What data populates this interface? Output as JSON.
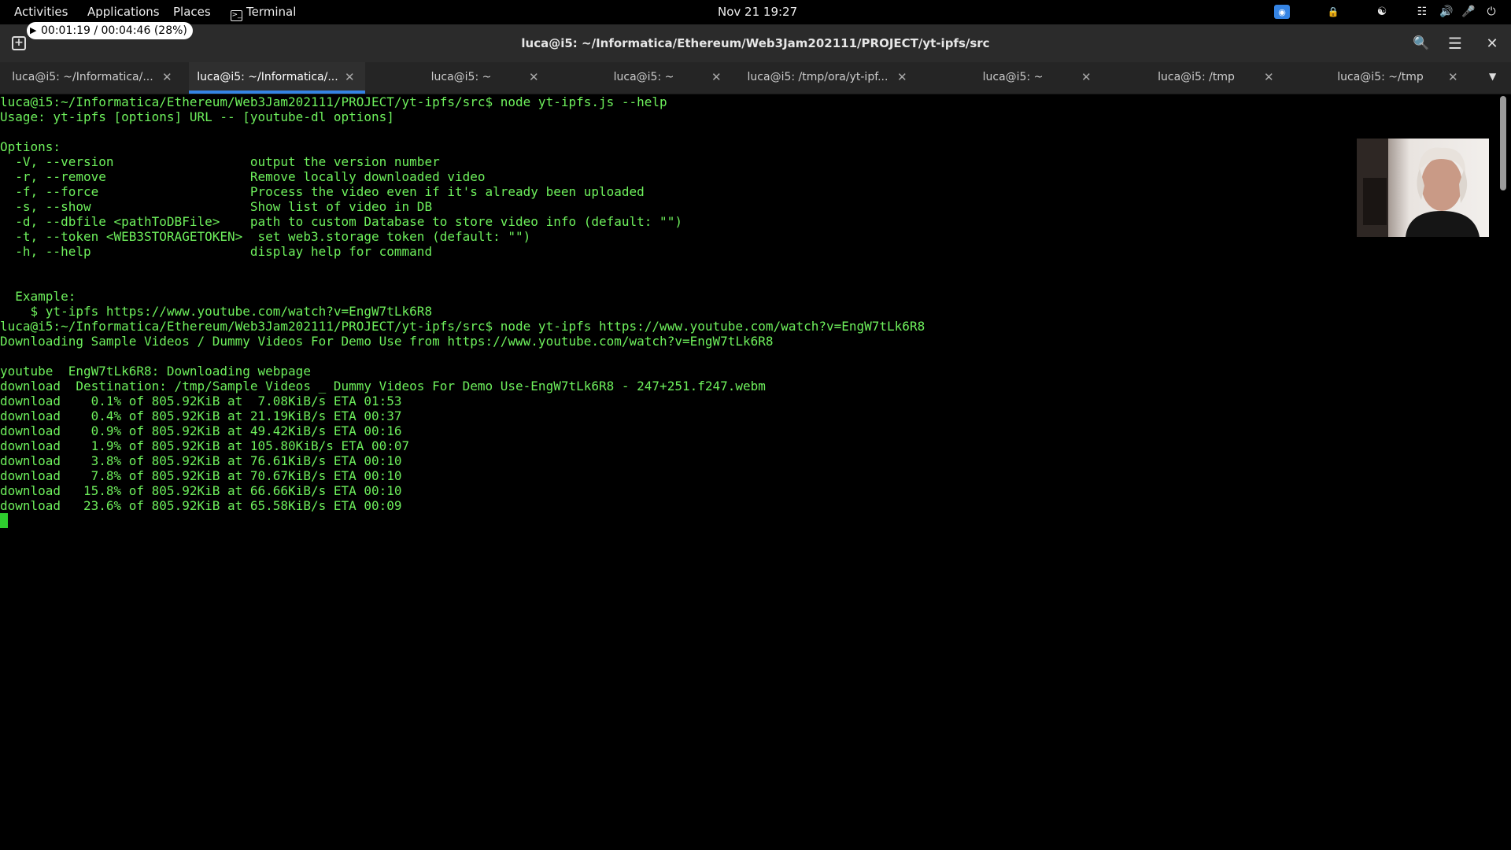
{
  "topbar": {
    "activities": "Activities",
    "applications": "Applications",
    "places": "Places",
    "terminal_app": "Terminal",
    "clock": "Nov 21  19:27"
  },
  "recording": {
    "status": "00:01:19 / 00:04:46 (28%)"
  },
  "window": {
    "title": "luca@i5: ~/Informatica/Ethereum/Web3Jam202111/PROJECT/yt-ipfs/src"
  },
  "tabs": [
    {
      "label": "luca@i5: ~/Informatica/..."
    },
    {
      "label": "luca@i5: ~/Informatica/..."
    },
    {
      "label": "luca@i5: ~"
    },
    {
      "label": "luca@i5: ~"
    },
    {
      "label": "luca@i5: /tmp/ora/yt-ipf..."
    },
    {
      "label": "luca@i5: ~"
    },
    {
      "label": "luca@i5: /tmp"
    },
    {
      "label": "luca@i5: ~/tmp"
    }
  ],
  "terminal": {
    "lines": [
      "luca@i5:~/Informatica/Ethereum/Web3Jam202111/PROJECT/yt-ipfs/src$ node yt-ipfs.js --help",
      "Usage: yt-ipfs [options] URL -- [youtube-dl options]",
      "",
      "Options:",
      "  -V, --version                  output the version number",
      "  -r, --remove                   Remove locally downloaded video",
      "  -f, --force                    Process the video even if it's already been uploaded",
      "  -s, --show                     Show list of video in DB",
      "  -d, --dbfile <pathToDBFile>    path to custom Database to store video info (default: \"\")",
      "  -t, --token <WEB3STORAGETOKEN>  set web3.storage token (default: \"\")",
      "  -h, --help                     display help for command",
      "",
      "",
      "  Example:",
      "    $ yt-ipfs https://www.youtube.com/watch?v=EngW7tLk6R8",
      "luca@i5:~/Informatica/Ethereum/Web3Jam202111/PROJECT/yt-ipfs/src$ node yt-ipfs https://www.youtube.com/watch?v=EngW7tLk6R8",
      "Downloading Sample Videos / Dummy Videos For Demo Use from https://www.youtube.com/watch?v=EngW7tLk6R8",
      "",
      "youtube  EngW7tLk6R8: Downloading webpage",
      "download  Destination: /tmp/Sample Videos _ Dummy Videos For Demo Use-EngW7tLk6R8 - 247+251.f247.webm",
      "download    0.1% of 805.92KiB at  7.08KiB/s ETA 01:53",
      "download    0.4% of 805.92KiB at 21.19KiB/s ETA 00:37",
      "download    0.9% of 805.92KiB at 49.42KiB/s ETA 00:16",
      "download    1.9% of 805.92KiB at 105.80KiB/s ETA 00:07",
      "download    3.8% of 805.92KiB at 76.61KiB/s ETA 00:10",
      "download    7.8% of 805.92KiB at 70.67KiB/s ETA 00:10",
      "download   15.8% of 805.92KiB at 66.66KiB/s ETA 00:10",
      "download   23.6% of 805.92KiB at 65.58KiB/s ETA 00:09"
    ]
  },
  "colors": {
    "terminal_text": "#6ef05c",
    "terminal_bg": "#000000",
    "tab_accent": "#3584e4"
  },
  "icons": [
    "terminal-icon",
    "camera-icon",
    "lock-icon",
    "accessibility-icon",
    "network-icon",
    "volume-icon",
    "microphone-icon",
    "power-icon",
    "new-tab-icon",
    "search-icon",
    "menu-icon",
    "close-icon",
    "tab-list-icon"
  ]
}
